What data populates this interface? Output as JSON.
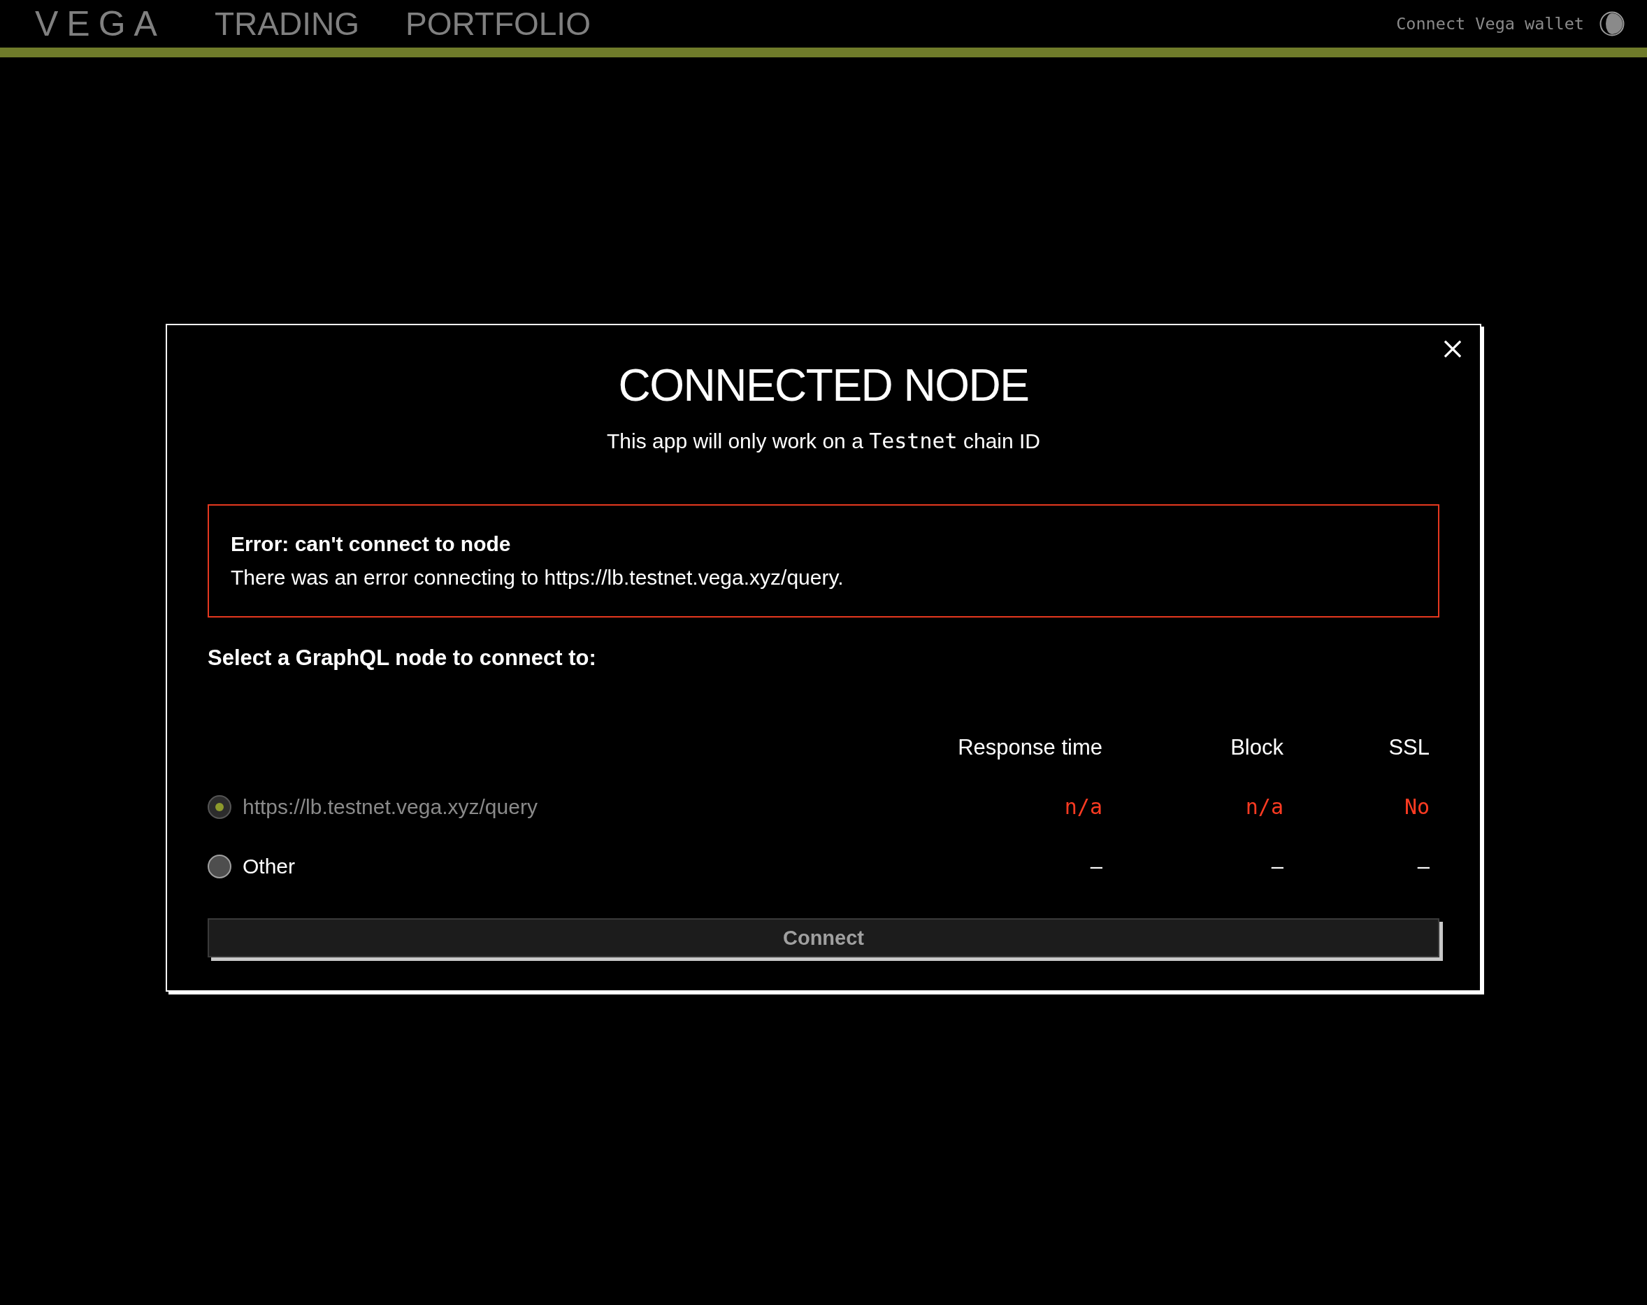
{
  "header": {
    "logo": "VEGA",
    "nav": [
      {
        "label": "TRADING",
        "selected": false
      },
      {
        "label": "PORTFOLIO",
        "selected": false
      }
    ],
    "wallet_button": "Connect Vega wallet"
  },
  "dialog": {
    "title": "CONNECTED NODE",
    "subtitle": {
      "before": "This app will only work on a ",
      "code": "Testnet",
      "after": " chain ID"
    },
    "error": {
      "title": "Error: can't connect to node",
      "message": "There was an error connecting to https://lb.testnet.vega.xyz/query."
    },
    "prompt": "Select a GraphQL node to connect to:",
    "columns": [
      "Response time",
      "Block",
      "SSL"
    ],
    "nodes": [
      {
        "label": "https://lb.testnet.vega.xyz/query",
        "selected": true,
        "disabled": true,
        "cells": [
          {
            "text": "n/a",
            "kind": "error"
          },
          {
            "text": "n/a",
            "kind": "error"
          },
          {
            "text": "No",
            "kind": "error"
          }
        ]
      },
      {
        "label": "Other",
        "selected": false,
        "disabled": false,
        "cells": [
          {
            "text": "–",
            "kind": "empty"
          },
          {
            "text": "–",
            "kind": "empty"
          },
          {
            "text": "–",
            "kind": "empty"
          }
        ]
      }
    ],
    "connect_button": {
      "label": "Connect",
      "disabled": true
    }
  }
}
